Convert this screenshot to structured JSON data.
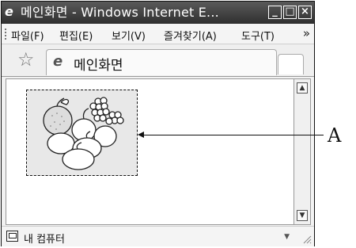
{
  "window": {
    "title": "메인화면 - Windows Internet E...",
    "buttons": {
      "minimize": "_",
      "maximize": "□",
      "close": "×"
    }
  },
  "menu": {
    "items": [
      "파일(F)",
      "편집(E)",
      "보기(V)",
      "즐겨찾기(A)",
      "도구(T)"
    ],
    "more": "»"
  },
  "tab": {
    "label": "메인화면"
  },
  "status": {
    "text": "내 컴퓨터"
  },
  "annotation": {
    "label": "A"
  },
  "icons": {
    "browser": "internet-explorer-icon",
    "favorites": "star-icon",
    "status": "computer-icon"
  }
}
